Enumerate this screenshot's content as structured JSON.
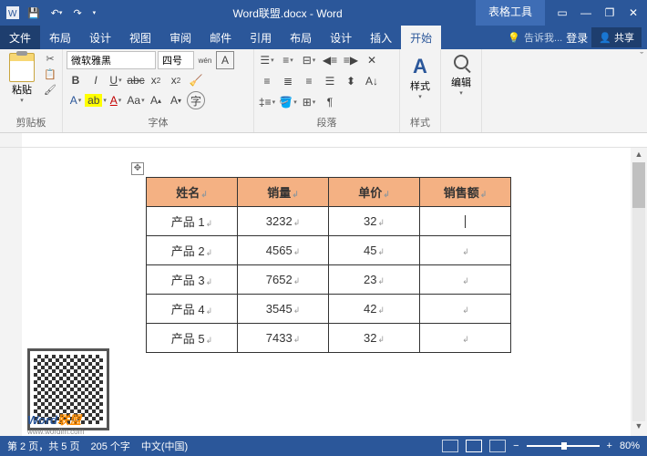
{
  "titlebar": {
    "filename": "Word联盟.docx - Word",
    "tool_context": "表格工具"
  },
  "tabs": {
    "file": "文件",
    "items": [
      "开始",
      "插入",
      "设计",
      "布局",
      "引用",
      "邮件",
      "审阅",
      "视图",
      "设计",
      "布局"
    ],
    "active": 0,
    "tell": "告诉我...",
    "login": "登录",
    "share": "共享"
  },
  "ribbon": {
    "clipboard": {
      "label": "剪贴板",
      "paste": "粘贴"
    },
    "font": {
      "label": "字体",
      "name": "微软雅黑",
      "size": "四号"
    },
    "paragraph": {
      "label": "段落"
    },
    "styles": {
      "label": "样式",
      "btn": "样式"
    },
    "editing": {
      "label": "",
      "btn": "编辑"
    }
  },
  "table": {
    "headers": [
      "姓名",
      "销量",
      "单价",
      "销售额"
    ],
    "rows": [
      [
        "产品 1",
        "3232",
        "32",
        ""
      ],
      [
        "产品 2",
        "4565",
        "45",
        ""
      ],
      [
        "产品 3",
        "7652",
        "23",
        ""
      ],
      [
        "产品 4",
        "3545",
        "42",
        ""
      ],
      [
        "产品 5",
        "7433",
        "32",
        ""
      ]
    ]
  },
  "watermark": {
    "brand_a": "Word",
    "brand_b": "联盟",
    "url": "www.wordlm.com"
  },
  "status": {
    "page": "第 2 页，共 5 页",
    "words": "205 个字",
    "lang": "中文(中国)",
    "zoom": "80%"
  },
  "chart_data": {
    "type": "table",
    "headers": [
      "姓名",
      "销量",
      "单价",
      "销售额"
    ],
    "rows": [
      {
        "姓名": "产品 1",
        "销量": 3232,
        "单价": 32,
        "销售额": null
      },
      {
        "姓名": "产品 2",
        "销量": 4565,
        "单价": 45,
        "销售额": null
      },
      {
        "姓名": "产品 3",
        "销量": 7652,
        "单价": 23,
        "销售额": null
      },
      {
        "姓名": "产品 4",
        "销量": 3545,
        "单价": 42,
        "销售额": null
      },
      {
        "姓名": "产品 5",
        "销量": 7433,
        "单价": 32,
        "销售额": null
      }
    ]
  }
}
